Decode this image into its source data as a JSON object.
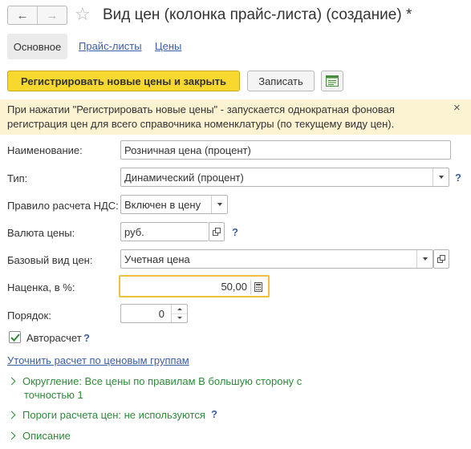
{
  "header": {
    "title": "Вид цен (колонка прайс-листа) (создание) *",
    "back_icon": "arrow-left-icon",
    "forward_icon": "arrow-right-icon",
    "favorite_icon": "star-icon"
  },
  "tabs": [
    {
      "label": "Основное"
    },
    {
      "label": "Прайс-листы"
    },
    {
      "label": "Цены"
    }
  ],
  "toolbar": {
    "register_label": "Регистрировать новые цены и закрыть",
    "save_label": "Записать",
    "extra_icon": "table-report-icon"
  },
  "info": {
    "text": "При нажатии \"Регистрировать новые цены\" - запускается однократная фоновая регистрация цен для всего справочника номенклатуры (по текущему виду цен).",
    "close_label": "×"
  },
  "form": {
    "name": {
      "label": "Наименование:",
      "value": "Розничная цена (процент)"
    },
    "type": {
      "label": "Тип:",
      "value": "Динамический (процент)",
      "help": "?"
    },
    "vat": {
      "label": "Правило расчета НДС:",
      "value": "Включен в цену"
    },
    "currency": {
      "label": "Валюта цены:",
      "value": "руб.",
      "help": "?"
    },
    "base_price": {
      "label": "Базовый вид цен:",
      "value": "Учетная цена"
    },
    "markup": {
      "label": "Наценка, в %:",
      "value": "50,00"
    },
    "order": {
      "label": "Порядок:",
      "value": "0"
    },
    "autocalc": {
      "label": "Авторасчет",
      "checked": true,
      "help": "?"
    }
  },
  "links": {
    "refine": "Уточнить расчет по ценовым группам"
  },
  "sections": {
    "rounding_line1": "Округление: Все цены по правилам В большую сторону с",
    "rounding_line2": "точностью 1",
    "thresholds": "Пороги расчета цен: не используются",
    "thresholds_help": "?",
    "description": "Описание"
  },
  "colors": {
    "accent_yellow": "#f7d82f",
    "link_blue": "#3b5ea5",
    "section_green": "#2e8a3a",
    "info_bg": "#fbf3d2",
    "focus_border": "#f0c23b"
  }
}
